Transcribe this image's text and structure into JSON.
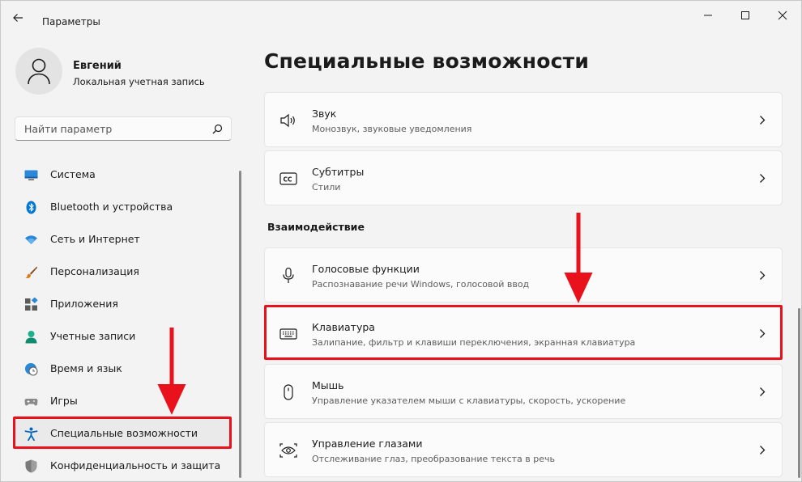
{
  "window": {
    "title": "Параметры"
  },
  "user": {
    "name": "Евгений",
    "account_type": "Локальная учетная запись"
  },
  "search": {
    "placeholder": "Найти параметр"
  },
  "sidebar": {
    "items": [
      {
        "label": "Система",
        "icon": "monitor-icon"
      },
      {
        "label": "Bluetooth и устройства",
        "icon": "bluetooth-icon"
      },
      {
        "label": "Сеть и Интернет",
        "icon": "wifi-icon"
      },
      {
        "label": "Персонализация",
        "icon": "brush-icon"
      },
      {
        "label": "Приложения",
        "icon": "apps-icon"
      },
      {
        "label": "Учетные записи",
        "icon": "person-icon"
      },
      {
        "label": "Время и язык",
        "icon": "globe-clock-icon"
      },
      {
        "label": "Игры",
        "icon": "gamepad-icon"
      },
      {
        "label": "Специальные возможности",
        "icon": "accessibility-icon"
      },
      {
        "label": "Конфиденциальность и защита",
        "icon": "shield-icon"
      }
    ]
  },
  "main": {
    "title": "Специальные возможности",
    "section_interaction": "Взаимодействие",
    "cards": [
      {
        "title": "Звук",
        "subtitle": "Монозвук, звуковые уведомления",
        "icon": "speaker-icon"
      },
      {
        "title": "Субтитры",
        "subtitle": "Стили",
        "icon": "cc-icon"
      },
      {
        "title": "Голосовые функции",
        "subtitle": "Распознавание речи Windows, голосовой ввод",
        "icon": "microphone-icon"
      },
      {
        "title": "Клавиатура",
        "subtitle": "Залипание, фильтр и клавиши переключения, экранная клавиатура",
        "icon": "keyboard-icon"
      },
      {
        "title": "Мышь",
        "subtitle": "Управление указателем мыши с клавиатуры, скорость, ускорение",
        "icon": "mouse-icon"
      },
      {
        "title": "Управление глазами",
        "subtitle": "Отслеживание глаз, преобразование текста в речь",
        "icon": "eye-control-icon"
      }
    ]
  },
  "colors": {
    "highlight": "#e8111c",
    "accent": "#0067c0"
  }
}
